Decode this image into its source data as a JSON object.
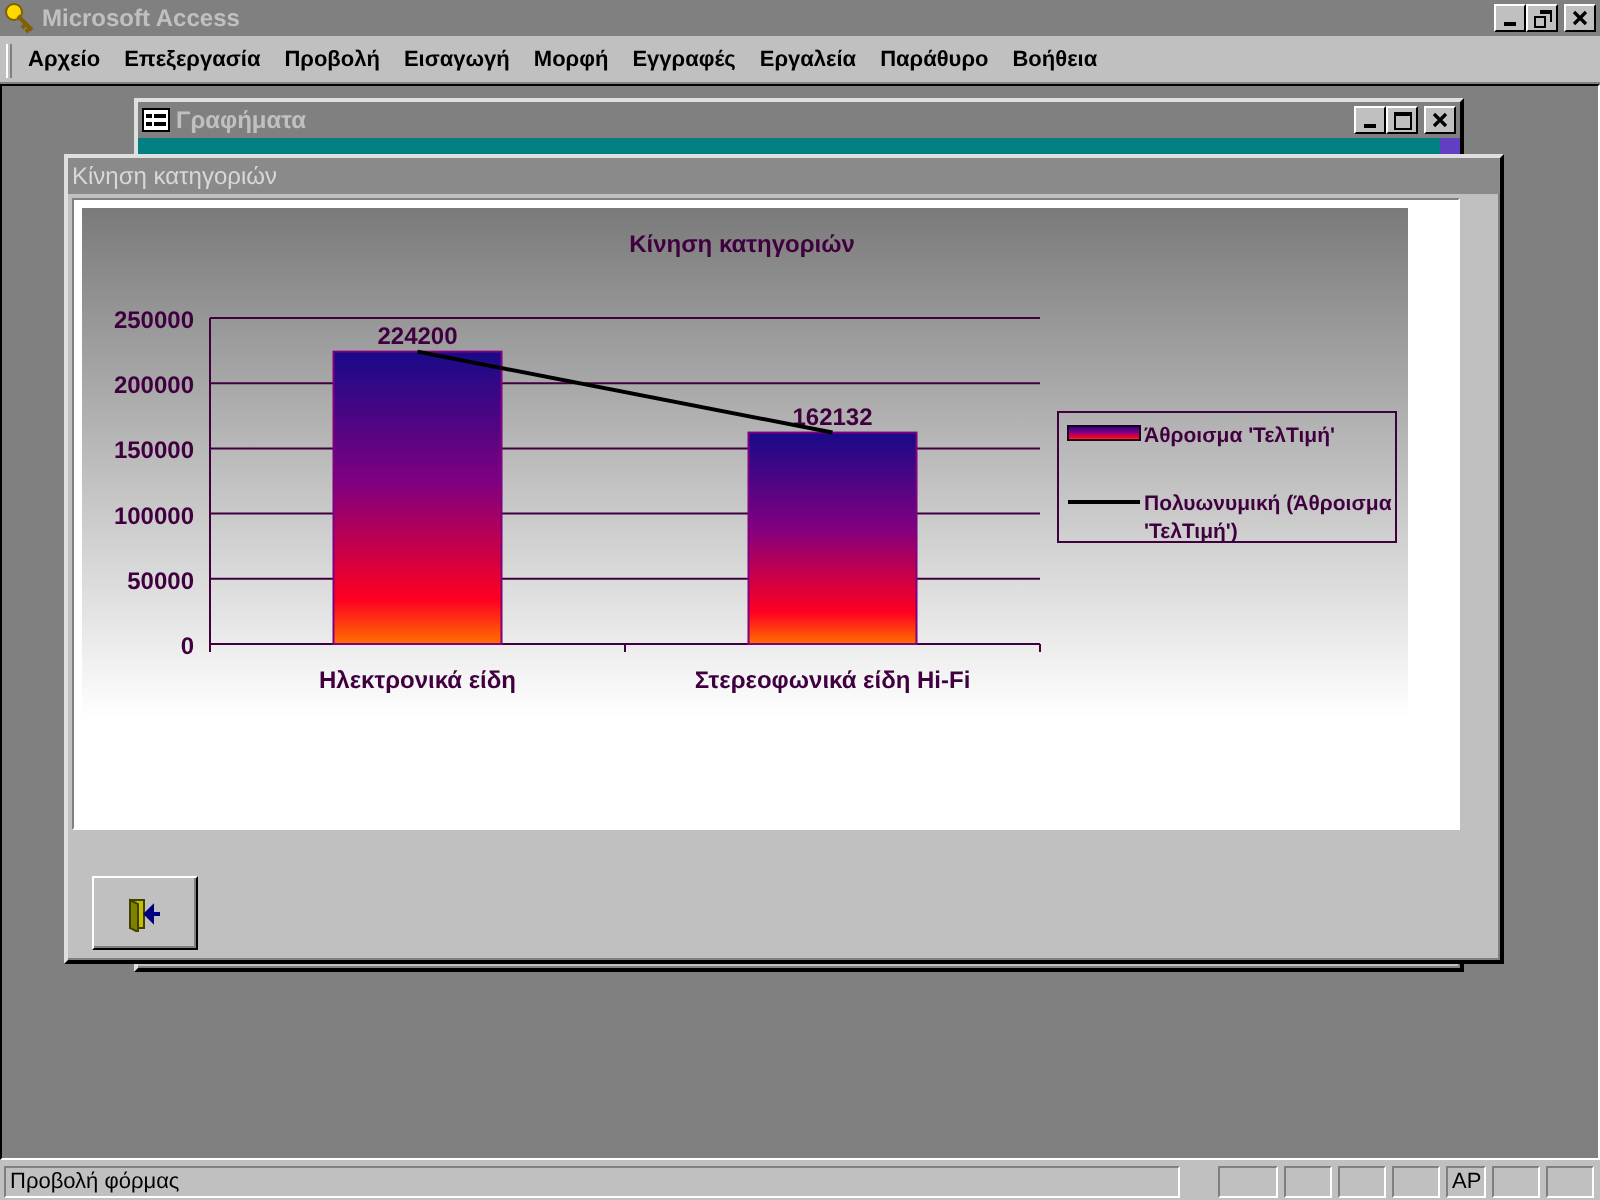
{
  "app_window": {
    "title": "Microsoft Access"
  },
  "menu": [
    "Αρχείο",
    "Επεξεργασία",
    "Προβολή",
    "Εισαγωγή",
    "Μορφή",
    "Εγγραφές",
    "Εργαλεία",
    "Παράθυρο",
    "Βοήθεια"
  ],
  "back_window": {
    "title": "Γραφήματα"
  },
  "front_window": {
    "title": "Κίνηση κατηγοριών",
    "chart_data": {
      "type": "bar",
      "title": "Κίνηση κατηγοριών",
      "categories": [
        "Ηλεκτρονικά είδη",
        "Στερεοφωνικά είδη Hi-Fi"
      ],
      "series": [
        {
          "name": "Άθροισμα 'ΤελΤιμή'",
          "color": "#800080",
          "values": [
            224200,
            162132
          ]
        },
        {
          "name": "Πολυωνυμική (Άθροισμα 'ΤελΤιμή')",
          "type": "line",
          "color": "#000000",
          "values": [
            224200,
            162132
          ]
        }
      ],
      "ylim": [
        0,
        250000
      ],
      "yticks": [
        0,
        50000,
        100000,
        150000,
        200000,
        250000
      ],
      "value_labels": [
        [
          "224200",
          "162132"
        ],
        [
          null,
          null
        ]
      ],
      "grid": true,
      "legend": "right"
    }
  },
  "status_bar": {
    "text": "Προβολή φόρμας",
    "indicator": "ΑΡ"
  }
}
